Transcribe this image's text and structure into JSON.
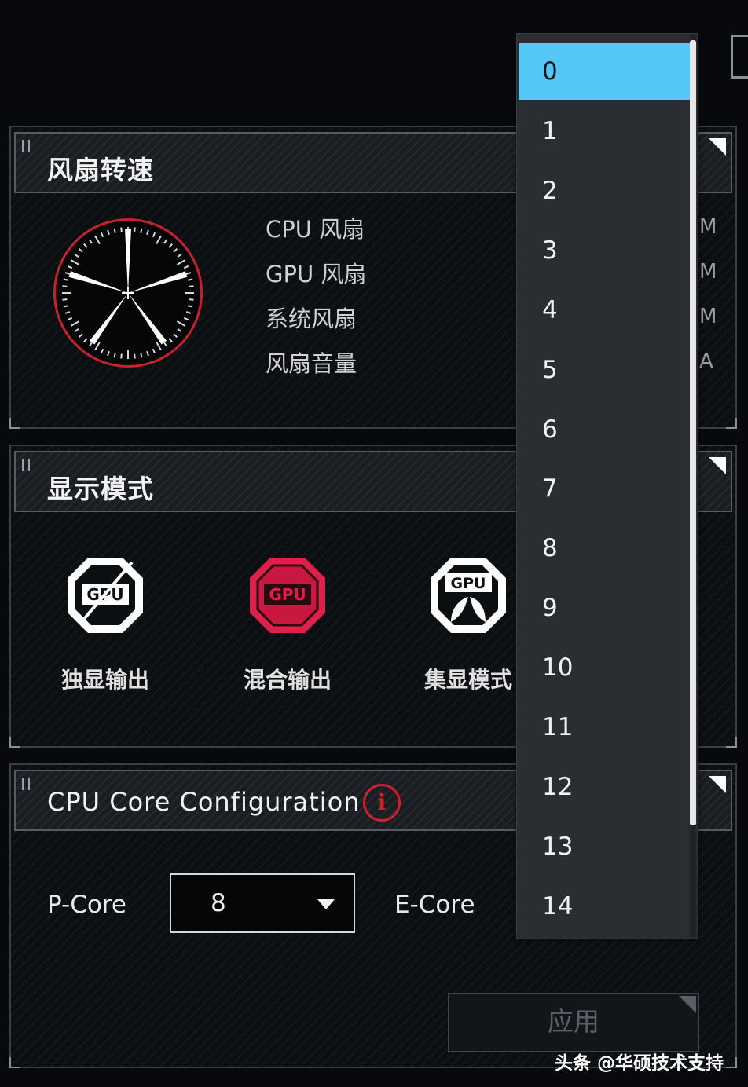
{
  "fan_panel": {
    "title": "风扇转速",
    "labels": [
      "CPU 风扇",
      "GPU 风扇",
      "系统风扇",
      "风扇音量"
    ]
  },
  "display_panel": {
    "title": "显示模式",
    "modes": [
      {
        "label": "独显输出",
        "chip_text": "GPU",
        "icon": "gpu-dgpu-icon",
        "active": false
      },
      {
        "label": "混合输出",
        "chip_text": "GPU",
        "icon": "gpu-hybrid-icon",
        "active": true
      },
      {
        "label": "集显模式",
        "chip_text": "GPU",
        "icon": "gpu-eco-icon",
        "active": false
      }
    ]
  },
  "cpu_panel": {
    "title": "CPU Core Configuration",
    "info_glyph": "i",
    "p_core_label": "P-Core",
    "p_core_value": "8",
    "e_core_label": "E-Core",
    "apply_label": "应用"
  },
  "dropdown": {
    "options": [
      "0",
      "1",
      "2",
      "3",
      "4",
      "5",
      "6",
      "7",
      "8",
      "9",
      "10",
      "11",
      "12",
      "13",
      "14"
    ],
    "selected": "0"
  },
  "edge_fragments": [
    "M",
    "M",
    "M",
    "A"
  ],
  "watermark": "头条 @华硕技术支持",
  "colors": {
    "accent_red": "#c8202c",
    "selection_blue": "#54c7f6",
    "background": "#07090c"
  }
}
